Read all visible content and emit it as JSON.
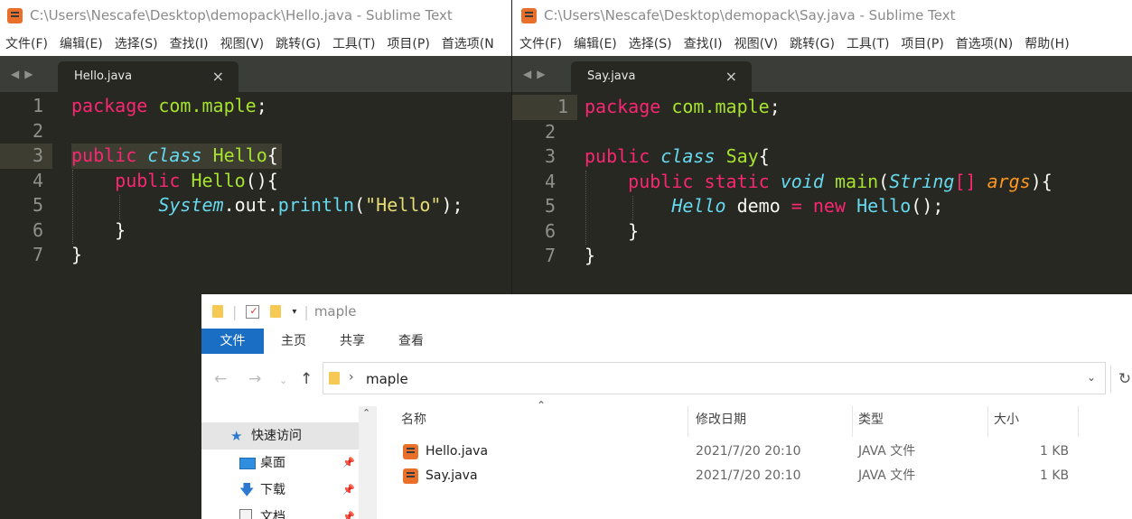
{
  "left_window": {
    "title": "C:\\Users\\Nescafe\\Desktop\\demopack\\Hello.java - Sublime Text",
    "menu": [
      "文件(F)",
      "编辑(E)",
      "选择(S)",
      "查找(I)",
      "视图(V)",
      "跳转(G)",
      "工具(T)",
      "项目(P)",
      "首选项(N"
    ],
    "tab_label": "Hello.java",
    "close_glyph": "×",
    "nav_glyphs": "◀▶",
    "line_numbers": [
      "1",
      "2",
      "3",
      "4",
      "5",
      "6",
      "7"
    ]
  },
  "right_window": {
    "title": "C:\\Users\\Nescafe\\Desktop\\demopack\\Say.java - Sublime Text",
    "menu": [
      "文件(F)",
      "编辑(E)",
      "选择(S)",
      "查找(I)",
      "视图(V)",
      "跳转(G)",
      "工具(T)",
      "项目(P)",
      "首选项(N)",
      "帮助(H)"
    ],
    "tab_label": "Say.java",
    "close_glyph": "×",
    "nav_glyphs": "◀▶",
    "line_numbers": [
      "1",
      "2",
      "3",
      "4",
      "5",
      "6",
      "7"
    ]
  },
  "explorer": {
    "title": "maple",
    "ribbon_tabs": [
      "文件",
      "主页",
      "共享",
      "查看"
    ],
    "address_path": "maple",
    "columns": [
      "名称",
      "修改日期",
      "类型",
      "大小"
    ],
    "sidebar": [
      {
        "label": "快速访问",
        "icon": "star-icon"
      },
      {
        "label": "桌面",
        "icon": "desktop-icon"
      },
      {
        "label": "下载",
        "icon": "download-icon"
      },
      {
        "label": "文档",
        "icon": "document-icon"
      }
    ],
    "files": [
      {
        "name": "Hello.java",
        "date": "2021/7/20 20:10",
        "type": "JAVA 文件",
        "size": "1 KB"
      },
      {
        "name": "Say.java",
        "date": "2021/7/20 20:10",
        "type": "JAVA 文件",
        "size": "1 KB"
      }
    ]
  },
  "colors": {
    "editor_bg": "#272822",
    "keyword": "#f92672",
    "storage": "#66d9ef",
    "type": "#a6e22e",
    "string": "#e6db74",
    "argument": "#fd971f",
    "accent": "#1a6fc4"
  }
}
